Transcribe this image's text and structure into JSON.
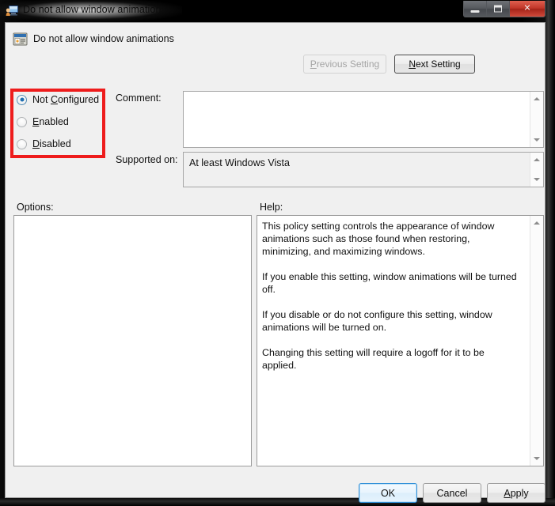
{
  "window": {
    "title": "Do not allow window animations",
    "title_icon": "policy-computer-icon",
    "controls": {
      "minimize": "minimize-button",
      "maximize": "maximize-button",
      "close": "close-button",
      "close_glyph": "✕"
    }
  },
  "header": {
    "icon": "policy-setting-icon",
    "title": "Do not allow window animations",
    "previous_setting": "Previous Setting",
    "previous_setting_pre": "P",
    "previous_setting_post": "revious Setting",
    "next_setting_pre": "N",
    "next_setting_post": "ext Setting",
    "previous_enabled": "false",
    "next_enabled": "true"
  },
  "state_options": {
    "selected": "Not Configured",
    "items": [
      {
        "pre": "Not ",
        "key": "C",
        "post": "onfigured",
        "checked": "true"
      },
      {
        "pre": "",
        "key": "E",
        "post": "nabled",
        "checked": "false"
      },
      {
        "pre": "",
        "key": "D",
        "post": "isabled",
        "checked": "false"
      }
    ]
  },
  "annotation": {
    "color": "#ee1c1c",
    "target": "state-options-group"
  },
  "fields": {
    "comment_label": "Comment:",
    "comment_value": "",
    "comment_placeholder": "",
    "supported_label": "Supported on:",
    "supported_value": "At least Windows Vista"
  },
  "panels": {
    "options_label": "Options:",
    "options_content": "",
    "help_label": "Help:",
    "help_paragraphs": [
      "This policy setting controls the appearance of window animations such as those found when restoring, minimizing, and maximizing windows.",
      "If you enable this setting, window animations will be turned off.",
      "If you disable or do not configure this setting, window animations will be turned on.",
      "Changing this setting will require a logoff for it to be applied."
    ]
  },
  "actions": {
    "ok": "OK",
    "cancel": "Cancel",
    "apply_pre": "",
    "apply_key": "A",
    "apply_post": "pply",
    "default_button": "OK"
  }
}
